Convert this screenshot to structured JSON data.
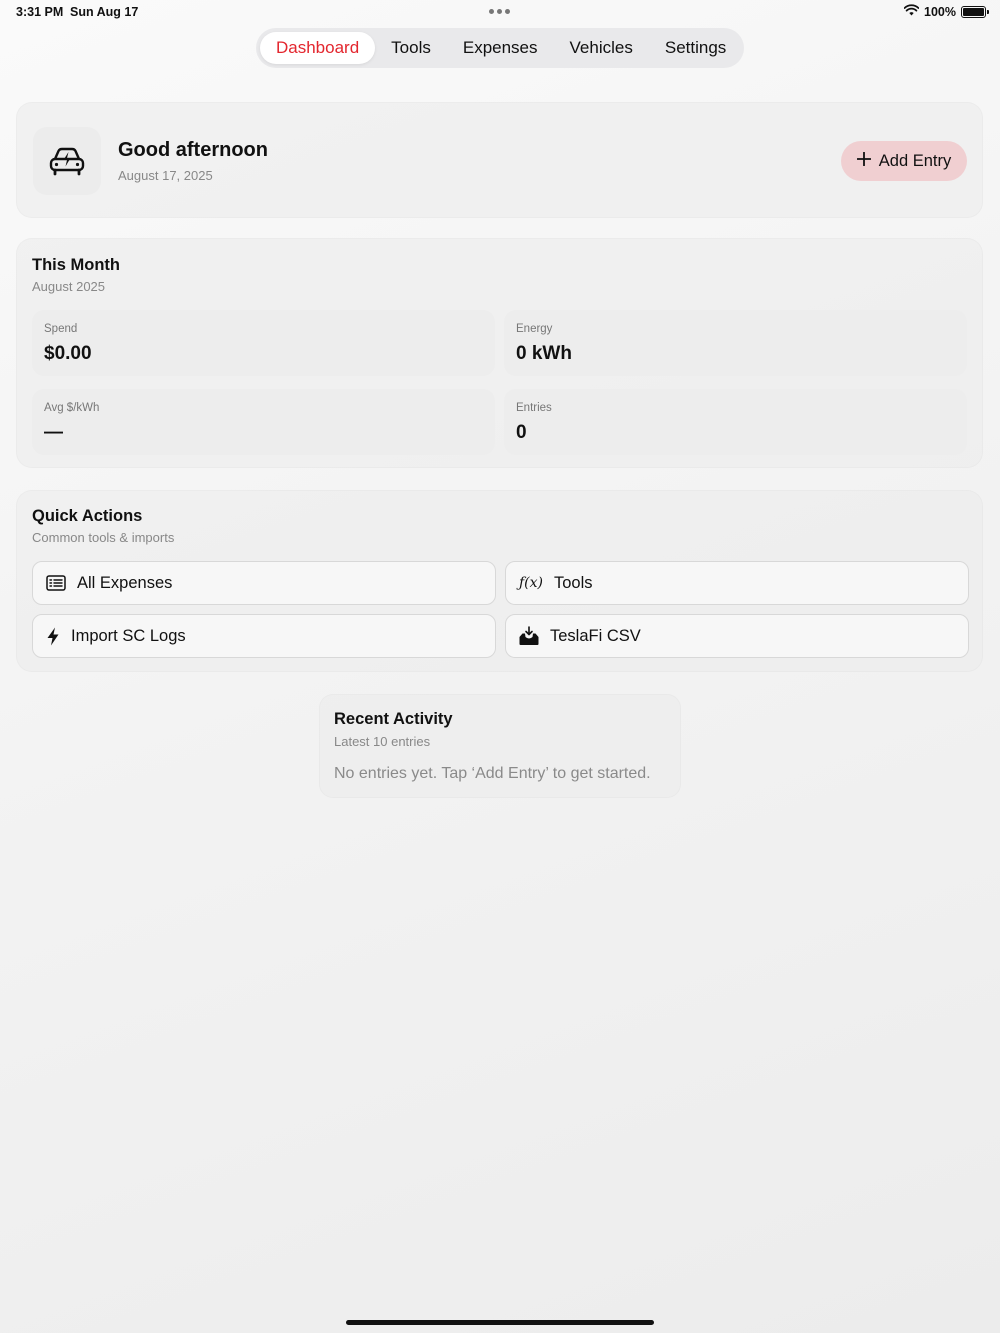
{
  "status_bar": {
    "time": "3:31 PM",
    "date": "Sun Aug 17",
    "battery": "100%",
    "icons": [
      "wifi-icon",
      "battery-icon"
    ]
  },
  "tabs": [
    {
      "label": "Dashboard",
      "active": true
    },
    {
      "label": "Tools",
      "active": false
    },
    {
      "label": "Expenses",
      "active": false
    },
    {
      "label": "Vehicles",
      "active": false
    },
    {
      "label": "Settings",
      "active": false
    }
  ],
  "greeting": {
    "title": "Good afternoon",
    "date": "August 17, 2025",
    "icon": "electric-car-icon",
    "add_button_label": "Add Entry"
  },
  "this_month": {
    "title": "This Month",
    "subtitle": "August 2025",
    "stats": [
      {
        "label": "Spend",
        "value": "$0.00"
      },
      {
        "label": "Energy",
        "value": "0 kWh"
      },
      {
        "label": "Avg $/kWh",
        "value": "—"
      },
      {
        "label": "Entries",
        "value": "0"
      }
    ]
  },
  "quick_actions": {
    "title": "Quick Actions",
    "subtitle": "Common tools & imports",
    "items": [
      {
        "label": "All Expenses",
        "icon": "list-icon"
      },
      {
        "label": "Tools",
        "icon": "function-icon"
      },
      {
        "label": "Import SC Logs",
        "icon": "bolt-icon"
      },
      {
        "label": "TeslaFi CSV",
        "icon": "tray-import-icon"
      }
    ]
  },
  "recent_activity": {
    "title": "Recent Activity",
    "subtitle": "Latest 10 entries",
    "empty_message": "No entries yet. Tap ‘Add Entry’ to get started."
  },
  "colors": {
    "accent": "#e3262e",
    "add_button_bg": "#f0cfd1",
    "background": "#f2f2f2"
  }
}
